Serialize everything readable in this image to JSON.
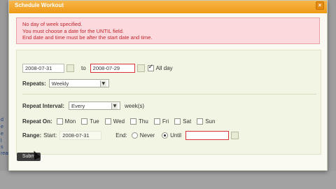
{
  "background": {
    "left_links": [
      "d",
      "e",
      "e",
      "l",
      "s",
      "ream"
    ],
    "submit_label": "Subm"
  },
  "modal": {
    "title": "Schedule Workout",
    "close_label": "×",
    "errors": [
      "No day of week specified.",
      "You must choose a date for the UNTIL field.",
      "End date and time must be after the start date and time."
    ]
  },
  "form": {
    "start_date": "2008-07-31",
    "to_label": "to",
    "end_date": "2008-07-29",
    "all_day_label": "All day",
    "all_day_checked": true,
    "repeats_label": "Repeats:",
    "repeats_value": "Weekly",
    "repeat_interval_label": "Repeat Interval:",
    "repeat_interval_value": "Every",
    "weeks_label": "week(s)",
    "repeat_on_label": "Repeat On:",
    "days": [
      "Mon",
      "Tue",
      "Wed",
      "Thu",
      "Fri",
      "Sat",
      "Sun"
    ],
    "range_label": "Range:",
    "range_start_label": "Start:",
    "range_start_value": "2008-07-31",
    "range_end_label": "End:",
    "never_label": "Never",
    "until_label": "Until",
    "until_value": ""
  },
  "colors": {
    "header": "#f5a623",
    "error_bg": "#fbd9dc",
    "error_text": "#c0262e",
    "form_bg": "#f2f5e3"
  }
}
